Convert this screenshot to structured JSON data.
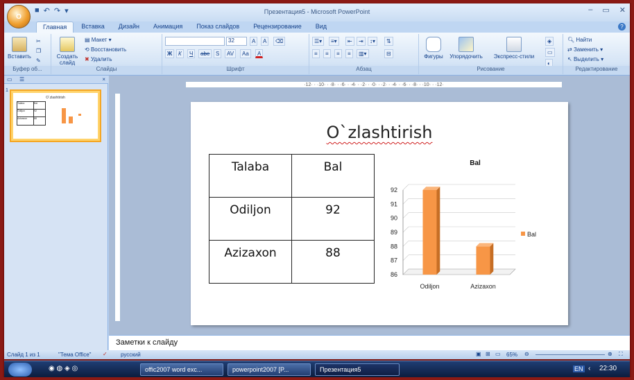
{
  "window": {
    "title": "Презентация5 - Microsoft PowerPoint",
    "office_button": "O",
    "minimize": "–",
    "maximize": "▭",
    "close": "✕"
  },
  "tabs": [
    "Главная",
    "Вставка",
    "Дизайн",
    "Анимация",
    "Показ слайдов",
    "Рецензирование",
    "Вид"
  ],
  "ribbon": {
    "clipboard": {
      "paste": "Вставить",
      "group": "Буфер об..."
    },
    "slides": {
      "layout": "Макет",
      "reset": "Восстановить",
      "delete": "Удалить",
      "new_slide": "Создать слайд",
      "group": "Слайды"
    },
    "font": {
      "size": "32",
      "group": "Шрифт",
      "bold": "Ж",
      "italic": "К",
      "underline": "Ч",
      "strike": "abe",
      "shadow": "S",
      "spacing": "AV",
      "case": "Aa",
      "color": "A",
      "grow": "A",
      "shrink": "A"
    },
    "paragraph": {
      "group": "Абзац"
    },
    "drawing": {
      "shapes": "Фигуры",
      "arrange": "Упорядочить",
      "quick_styles": "Экспресс-стили",
      "group": "Рисование"
    },
    "editing": {
      "find": "Найти",
      "replace": "Заменить",
      "select": "Выделить",
      "group": "Редактирование"
    }
  },
  "ruler": {
    "h": "·12·  ·  ·10·  ·  ·8·  ·  ·6·  ·  ·4·  ·  ·2·  ·  ·0·  ·  ·2·  ·  ·4·  ·  ·6·  ·  ·8·  ·  ·10·  ·  ·12·"
  },
  "thumbnail": {
    "number": "1",
    "title": "O`zlashtirish",
    "headers": [
      "Talaba",
      "Bal"
    ],
    "rows": [
      [
        "Odiljon",
        "92"
      ],
      [
        "Azizaxon",
        "88"
      ]
    ]
  },
  "slide": {
    "title": "O`zlashtirish",
    "table": {
      "headers": [
        "Talaba",
        "Bal"
      ],
      "rows": [
        [
          "Odiljon",
          "92"
        ],
        [
          "Azizaxon",
          "88"
        ]
      ]
    }
  },
  "chart_data": {
    "type": "bar",
    "title": "Bal",
    "categories": [
      "Odiljon",
      "Azizaxon"
    ],
    "series": [
      {
        "name": "Bal",
        "values": [
          92,
          88
        ],
        "color": "#f79646"
      }
    ],
    "ylim": [
      86,
      92
    ],
    "yticks": [
      "86",
      "87",
      "88",
      "89",
      "90",
      "91",
      "92"
    ],
    "legend": "right",
    "grid": true
  },
  "notes": "Заметки к слайду",
  "status": {
    "slide": "Слайд 1 из 1",
    "theme": "\"Тема Office\"",
    "lang": "русский",
    "zoom": "65%"
  },
  "taskbar": {
    "tasks": [
      "offic2007 word exc...",
      "powerpoint2007 [P...",
      "Презентация5"
    ],
    "lang": "EN",
    "time": "22:30"
  }
}
